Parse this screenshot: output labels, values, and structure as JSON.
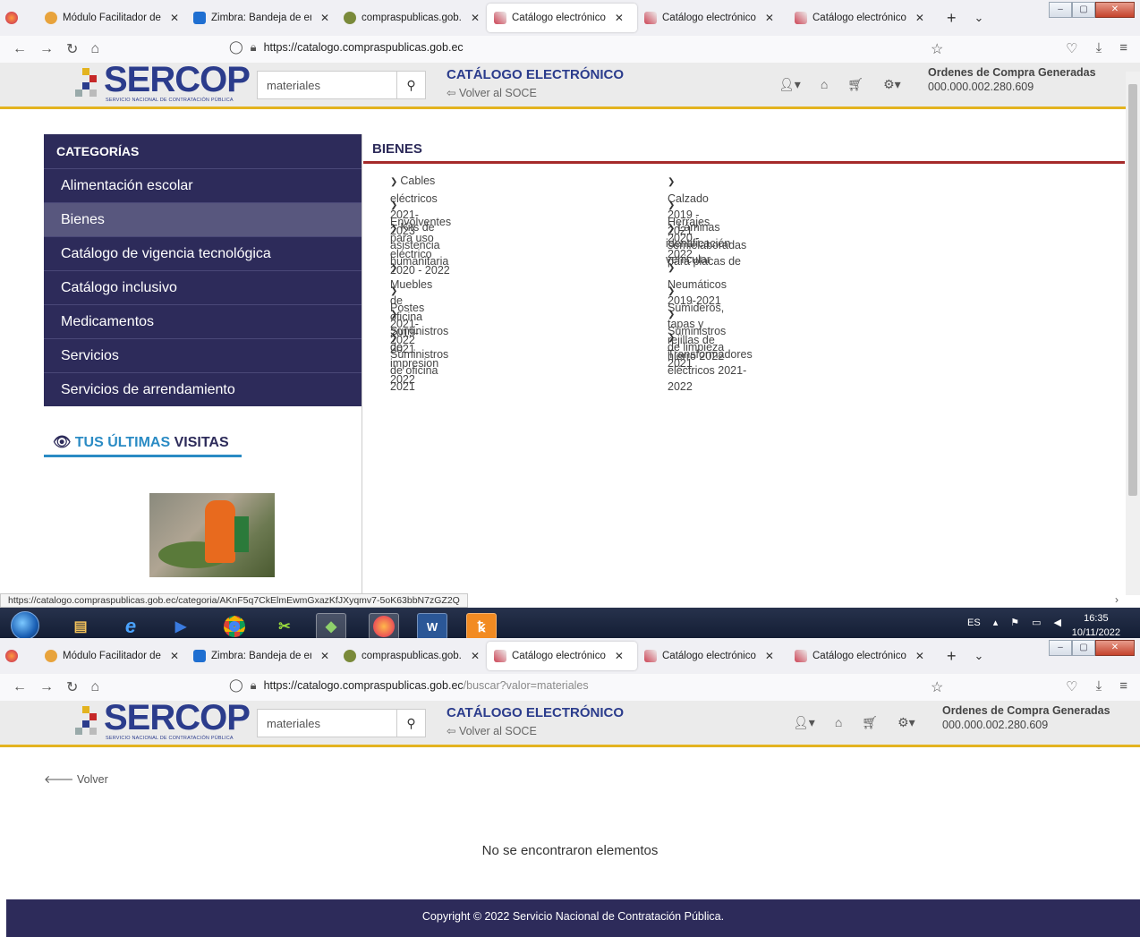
{
  "tabs": [
    {
      "title": "Módulo Facilitador de l",
      "icon": "facilitador-icon",
      "color": "#e8a33c"
    },
    {
      "title": "Zimbra: Bandeja de entr",
      "icon": "zimbra-icon",
      "color": "#1f6fd1"
    },
    {
      "title": "compraspublicas.gob.e",
      "icon": "sercop-icon",
      "color": "#7a8a3a"
    },
    {
      "title": "Catálogo electrónico",
      "icon": "catalog-icon",
      "color": "#c45"
    },
    {
      "title": "Catálogo electrónico",
      "icon": "catalog-icon",
      "color": "#c45"
    },
    {
      "title": "Catálogo electrónico",
      "icon": "catalog-icon",
      "color": "#c45"
    }
  ],
  "top": {
    "url_host": "https://catalogo.compraspublicas.gob.ec",
    "url_rest": "",
    "search_value": "materiales",
    "catalog_title": "CATÁLOGO ELECTRÓNICO",
    "volver_soce": "Volver al SOCE",
    "ordenes_title": "Ordenes de Compra Generadas",
    "ordenes_num": "000.000.002.280.609",
    "categorias_label": "CATEGORÍAS",
    "categories": [
      "Alimentación escolar",
      "Bienes",
      "Catálogo de vigencia tecnológica",
      "Catálogo inclusivo",
      "Medicamentos",
      "Servicios",
      "Servicios de arrendamiento"
    ],
    "selected_category": "Bienes",
    "bienes_title": "BIENES",
    "bienes_col1": [
      "Cables eléctricos 2021-2023",
      "Envolventes para uso eléctrico 2020 - 2022",
      "Kits de asistencia humanitaria",
      "Muebles de oficina 2019-2021",
      "Postes 2021-2022",
      "Suministros de impresion 2022",
      "Suministros de oficina 2021"
    ],
    "bienes_col2": [
      "Calzado 2019 - 2021",
      "Herrajes 2020 - 2022",
      "Láminas semielaboradas para placas de",
      "identificación vehicular",
      "Neumáticos 2019-2021",
      "Sumideros, tapas y rejillas de hierro 2022",
      "Suministros de limpieza 2021",
      "Transformadores eléctricos 2021-2022"
    ],
    "visitas_a": "TUS ÚLTIMAS",
    "visitas_b": "VISITAS",
    "status_url": "https://catalogo.compraspublicas.gob.ec/categoria/AKnF5q7CkElmEwmGxazKfJXyqmv7-5oK63bbN7zGZ2Q"
  },
  "bottom": {
    "url_host": "https://catalogo.compraspublicas.gob.ec",
    "url_rest": "/buscar?valor=materiales",
    "search_value": "materiales",
    "catalog_title": "CATÁLOGO ELECTRÓNICO",
    "volver_soce": "Volver al SOCE",
    "ordenes_title": "Ordenes de Compra Generadas",
    "ordenes_num": "000.000.002.280.609",
    "back_label": "Volver",
    "no_items": "No se encontraron elementos",
    "footer": "Copyright © 2022 Servicio Nacional de Contratación Pública."
  },
  "logo": {
    "word": "SERCOP",
    "tag": "SERVICIO NACIONAL DE CONTRATACIÓN PÚBLICA"
  },
  "taskbar": {
    "lang": "ES",
    "time": "16:35",
    "date": "10/11/2022"
  },
  "colors": {
    "brand": "#2d2b5a",
    "accent": "#e3b31f",
    "link_blue": "#2a8bc4",
    "rule": "#a52a2a"
  }
}
